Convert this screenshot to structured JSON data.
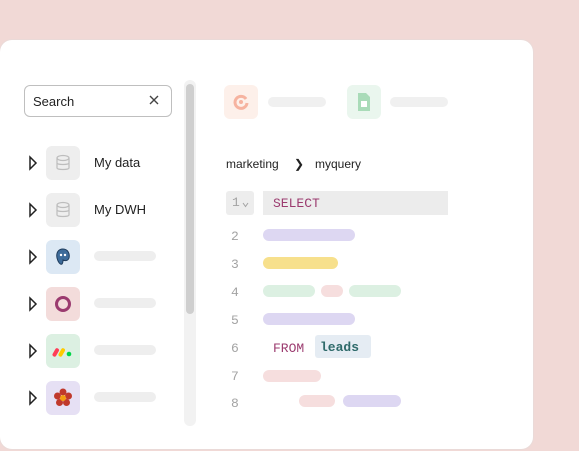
{
  "search": {
    "value": "Search"
  },
  "tree": {
    "items": [
      {
        "label": "My data",
        "icon": "database-icon"
      },
      {
        "label": "My DWH",
        "icon": "database-icon"
      },
      {
        "label": "",
        "icon": "postgresql-icon"
      },
      {
        "label": "",
        "icon": "ring-icon"
      },
      {
        "label": "",
        "icon": "monday-icon"
      },
      {
        "label": "",
        "icon": "flower-icon"
      }
    ]
  },
  "header": {
    "tabs": [
      {
        "icon": "refresh-icon"
      },
      {
        "icon": "sheets-icon"
      }
    ]
  },
  "breadcrumb": {
    "left": "marketing",
    "separator": "❯",
    "right": "myquery"
  },
  "editor": {
    "line1": "1",
    "keyword_select": "SELECT",
    "line2": "2",
    "line3": "3",
    "line4": "4",
    "line5": "5",
    "line6": "6",
    "keyword_from": "FROM",
    "table_leads": "leads",
    "line7": "7",
    "line8": "8"
  },
  "colors": {
    "accent": "#9b3b6f",
    "lavender": "#ddd7f2",
    "yellow": "#f7e08c",
    "green": "#dcf0e2",
    "pink": "#f6dede"
  }
}
